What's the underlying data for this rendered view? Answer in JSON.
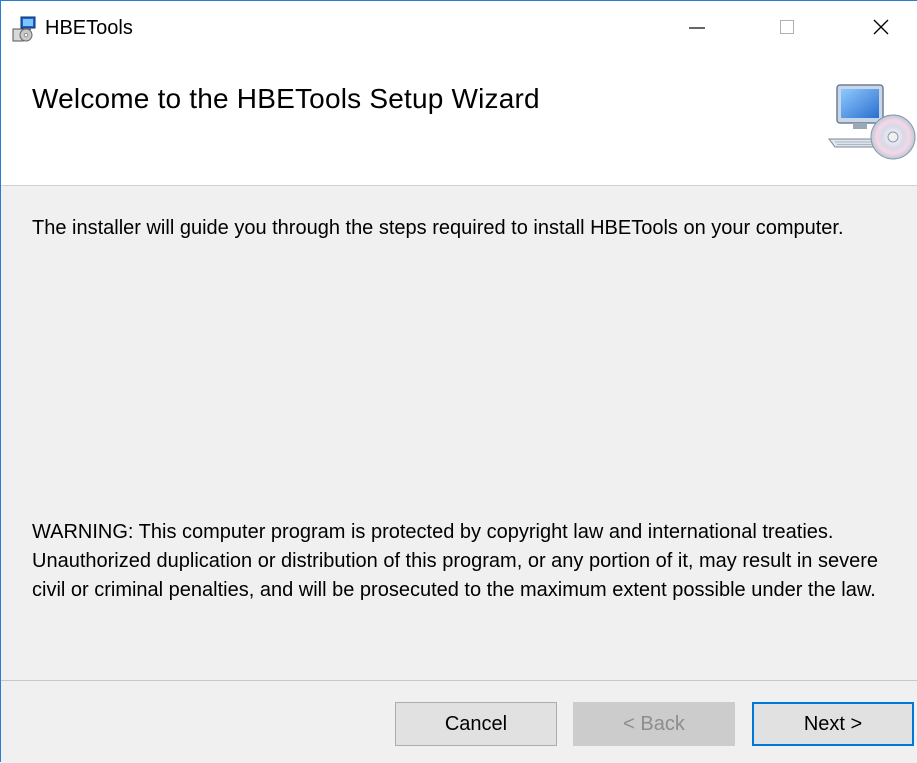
{
  "window": {
    "title": "HBETools",
    "controls": {
      "minimize_icon": "minimize-icon",
      "maximize_icon": "maximize-icon",
      "close_icon": "close-icon"
    }
  },
  "header": {
    "title": "Welcome to the HBETools Setup Wizard",
    "graphic_icon": "computer-cd-icon"
  },
  "content": {
    "intro": "The installer will guide you through the steps required to install HBETools on your computer.",
    "warning": "WARNING: This computer program is protected by copyright law and international treaties. Unauthorized duplication or distribution of this program, or any portion of it, may result in severe civil or criminal penalties, and will be prosecuted to the maximum extent possible under the law."
  },
  "footer": {
    "cancel_label": "Cancel",
    "back_label": "< Back",
    "next_label": "Next >"
  },
  "colors": {
    "accent": "#0078d7",
    "window_border": "#2b7bd1",
    "dialog_bg": "#f0f0f0",
    "disabled_text": "#8d8d8d"
  }
}
